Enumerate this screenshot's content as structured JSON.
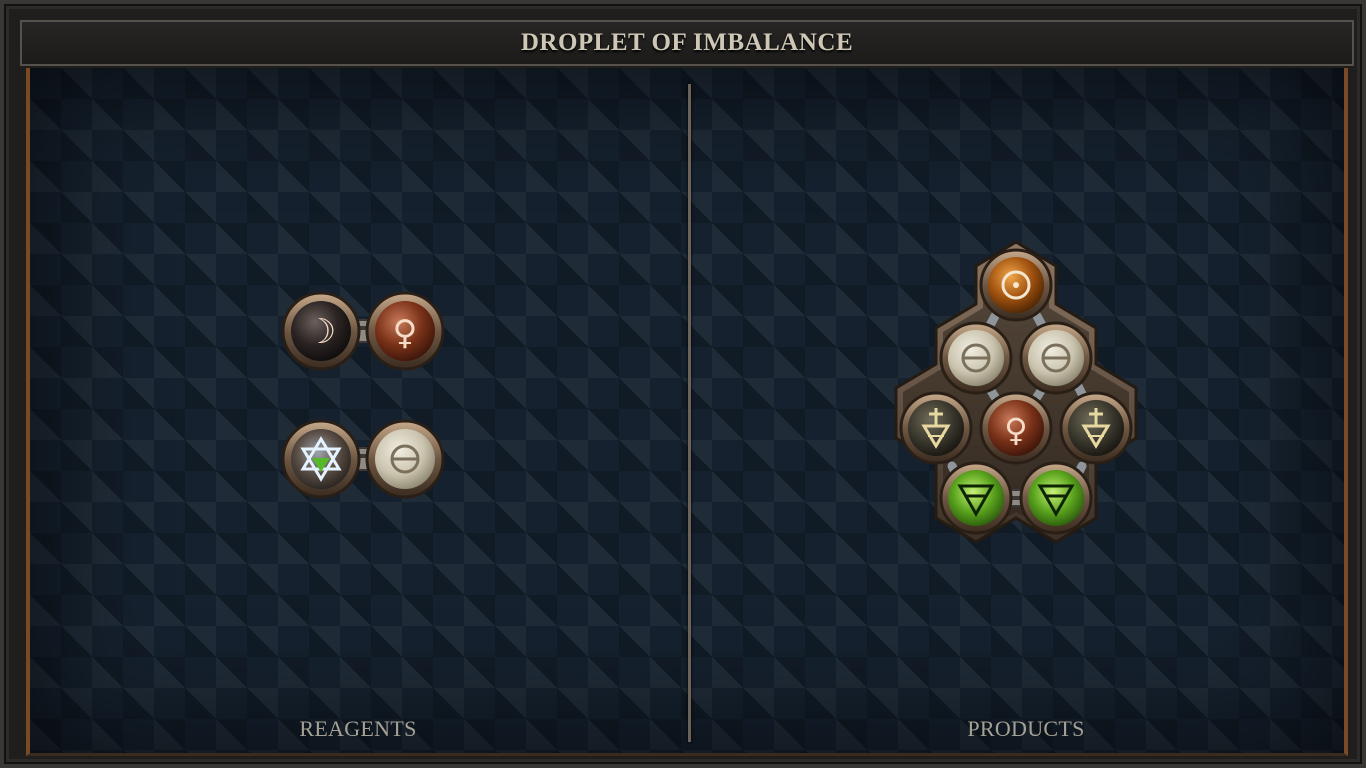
{
  "title": "DROPLET OF IMBALANCE",
  "panels": {
    "reagents_label": "REAGENTS",
    "products_label": "PRODUCTS"
  },
  "colors": {
    "frame": "#3a3835",
    "board_background": "#15212e",
    "accent_copper": "#7a4a27",
    "label_text": "#a6a196"
  },
  "reagents": [
    {
      "atoms": [
        {
          "element": "salt-moon",
          "glyph": "☽",
          "color": "#2b2524"
        },
        {
          "element": "copper",
          "glyph": "♀",
          "color": "#8a3f22"
        }
      ]
    },
    {
      "atoms": [
        {
          "element": "quintessence",
          "glyph": "✡",
          "color": "#4a4540"
        },
        {
          "element": "salt",
          "glyph": "⊖",
          "color": "#d7d2c1"
        }
      ]
    }
  ],
  "product": {
    "atoms": [
      {
        "element": "gold",
        "glyph": "☉",
        "color": "#b5651d"
      },
      {
        "element": "salt",
        "glyph": "⊖",
        "color": "#d7d2c1"
      },
      {
        "element": "salt",
        "glyph": "⊖",
        "color": "#d7d2c1"
      },
      {
        "element": "earth-sulfur",
        "glyph": "🜍",
        "color": "#34312a"
      },
      {
        "element": "copper",
        "glyph": "♀",
        "color": "#8a3f22"
      },
      {
        "element": "earth-sulfur",
        "glyph": "🜍",
        "color": "#34312a"
      },
      {
        "element": "earth",
        "glyph": "🜃",
        "color": "#5aa02c"
      },
      {
        "element": "earth",
        "glyph": "🜃",
        "color": "#5aa02c"
      }
    ]
  }
}
